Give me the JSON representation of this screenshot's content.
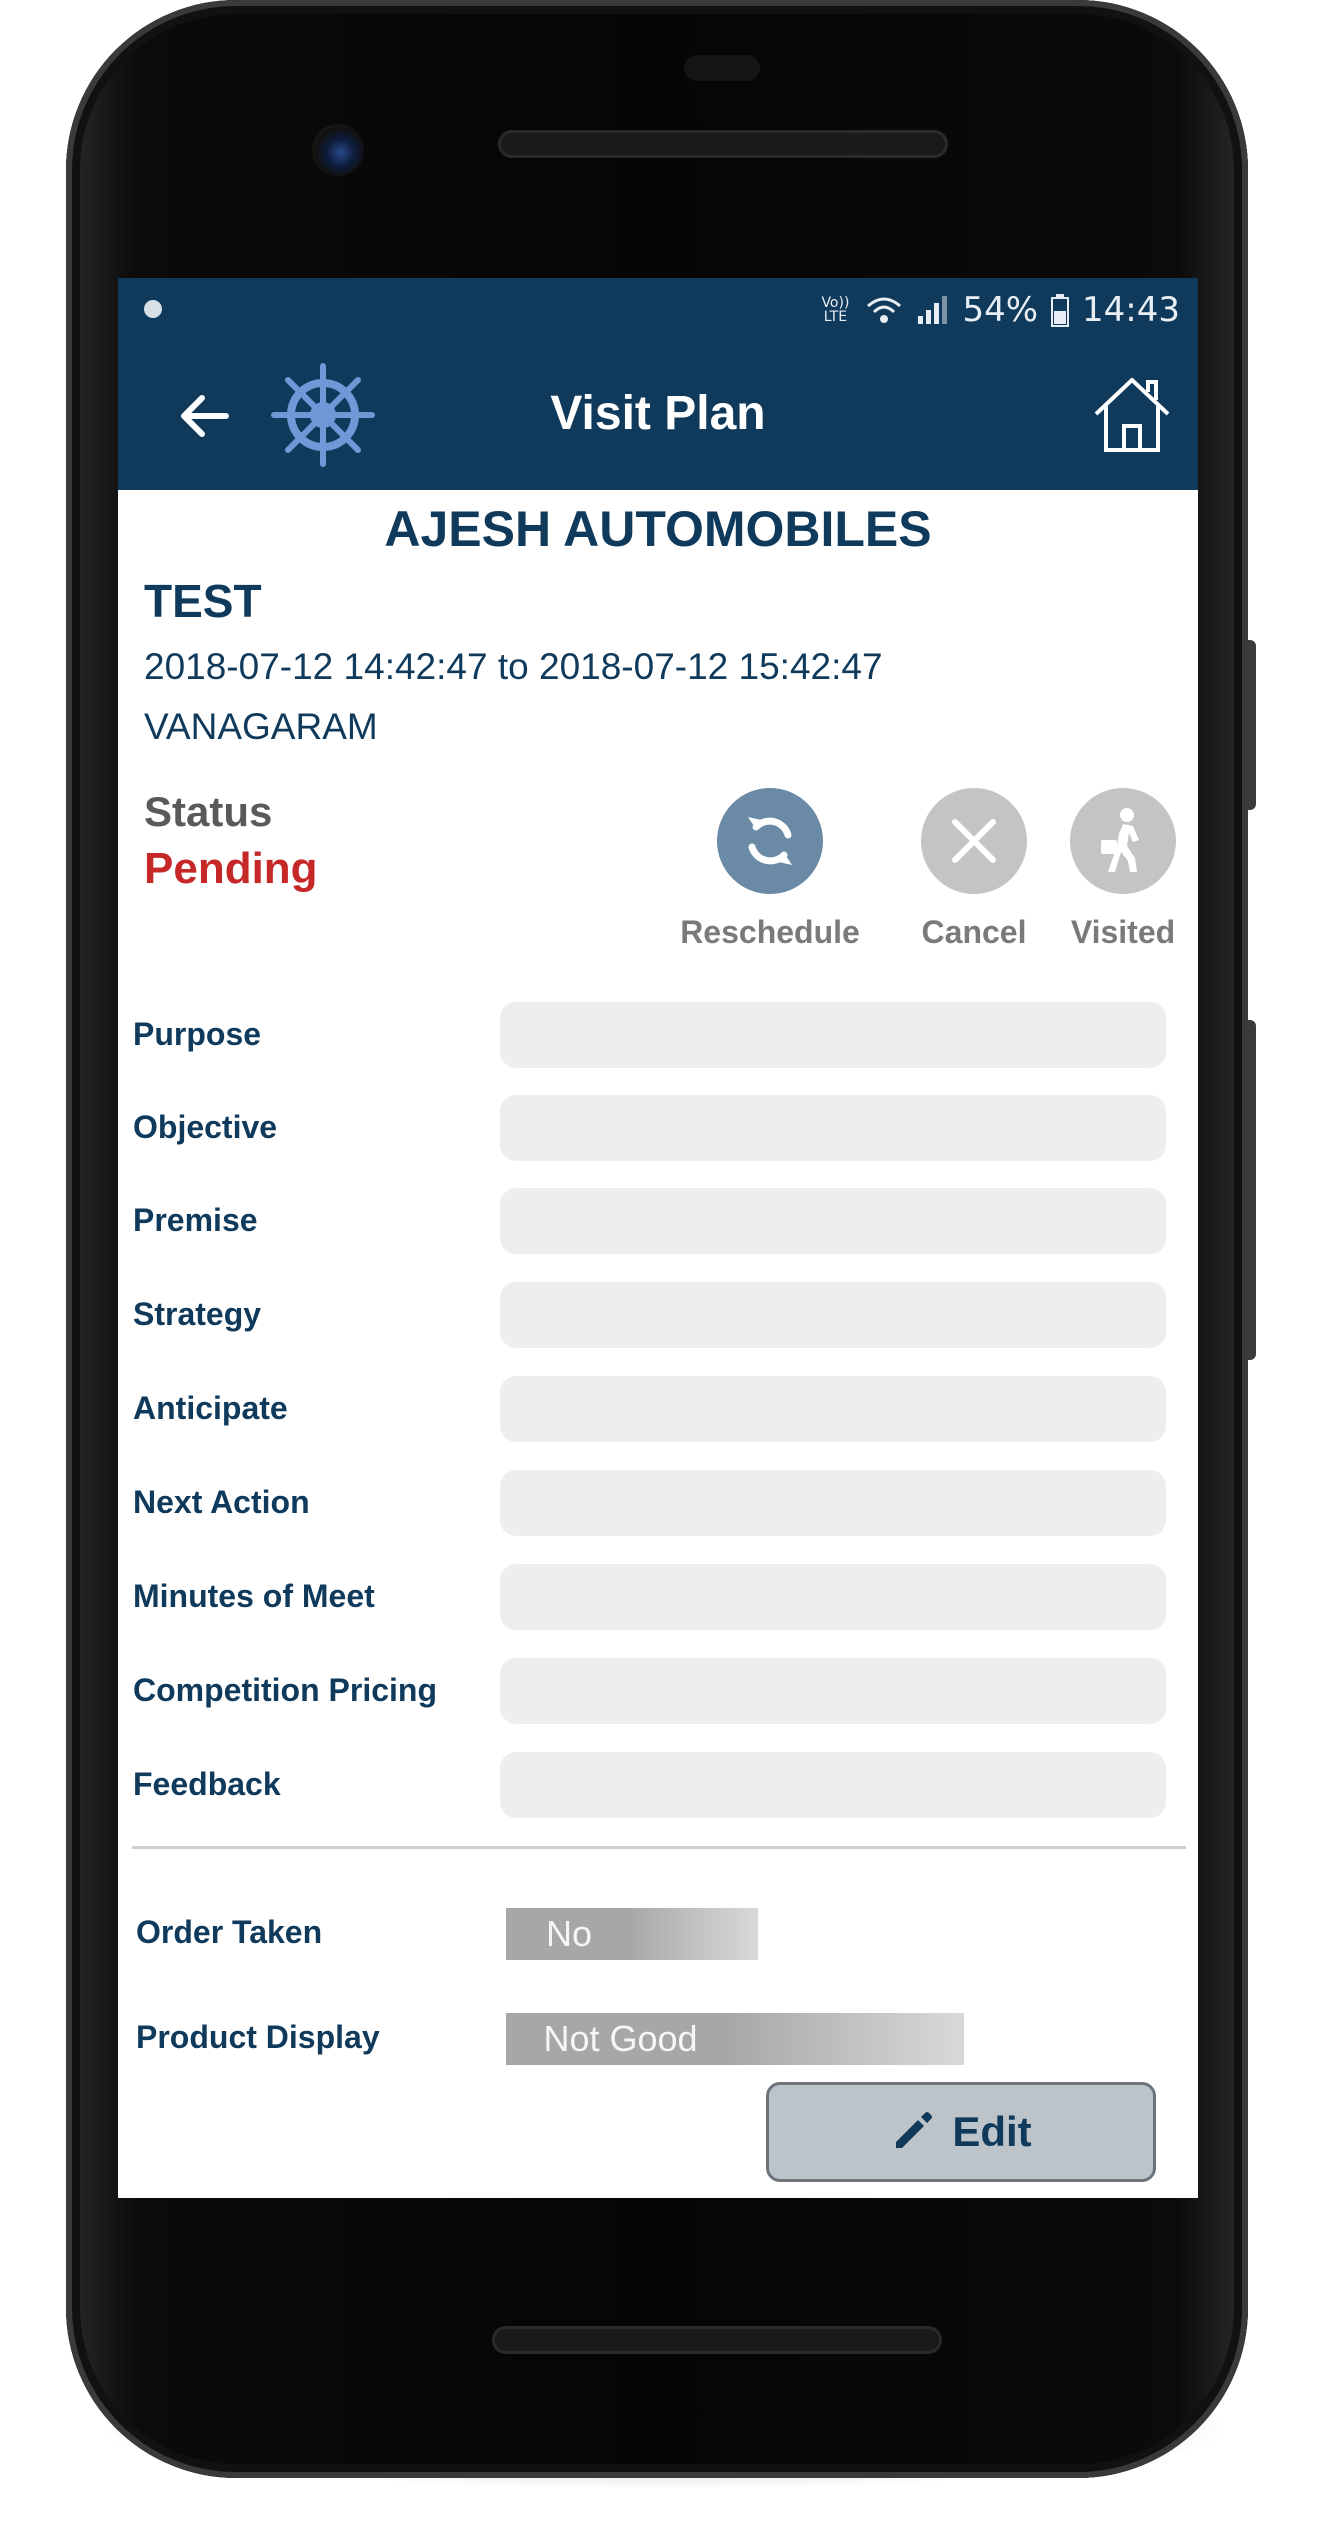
{
  "status_bar": {
    "network": "Vo)) LTE",
    "battery": "54%",
    "time": "14:43"
  },
  "app_bar": {
    "title": "Visit Plan"
  },
  "visit": {
    "company": "AJESH AUTOMOBILES",
    "name": "TEST",
    "date_range": "2018-07-12 14:42:47 to 2018-07-12 15:42:47",
    "location": "VANAGARAM",
    "status_label": "Status",
    "status_value": "Pending"
  },
  "actions": [
    {
      "label": "Reschedule",
      "icon": "refresh-icon",
      "color": "#6a8aa6"
    },
    {
      "label": "Cancel",
      "icon": "close-icon",
      "color": "#c4c4c4"
    },
    {
      "label": "Visited",
      "icon": "walking-person-icon",
      "color": "#c4c4c4"
    }
  ],
  "fields": [
    {
      "label": "Purpose",
      "value": ""
    },
    {
      "label": "Objective",
      "value": ""
    },
    {
      "label": "Premise",
      "value": ""
    },
    {
      "label": "Strategy",
      "value": ""
    },
    {
      "label": "Anticipate",
      "value": ""
    },
    {
      "label": "Next Action",
      "value": ""
    },
    {
      "label": "Minutes of Meet",
      "value": ""
    },
    {
      "label": "Competition Pricing",
      "value": ""
    },
    {
      "label": "Feedback",
      "value": ""
    }
  ],
  "order_taken": {
    "label": "Order Taken",
    "value": "No"
  },
  "product_display": {
    "label": "Product Display",
    "value": "Not Good"
  },
  "edit_button": {
    "label": "Edit"
  },
  "colors": {
    "primary": "#0f3a5c",
    "pending": "#c62828",
    "field_bg": "#eeeeee"
  }
}
